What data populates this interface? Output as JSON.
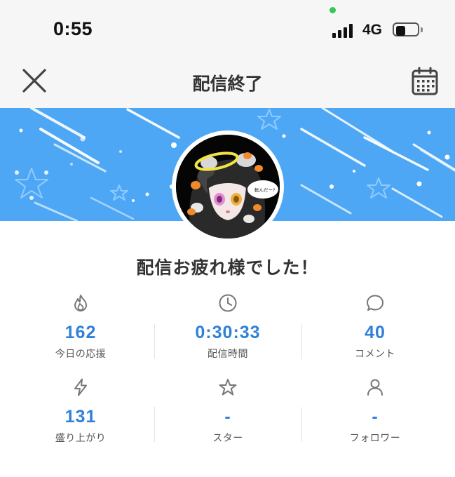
{
  "status_bar": {
    "time": "0:55",
    "network": "4G",
    "battery_percent": 35
  },
  "nav": {
    "title": "配信終了",
    "close_icon": "close-icon",
    "calendar_icon": "calendar-icon"
  },
  "avatar": {
    "speech_bubble_text": "転んだー?"
  },
  "message": "配信お疲れ様でした！",
  "stats": [
    {
      "icon": "flame-icon",
      "value": "162",
      "label": "今日の応援"
    },
    {
      "icon": "clock-icon",
      "value": "0:30:33",
      "label": "配信時間"
    },
    {
      "icon": "comment-icon",
      "value": "40",
      "label": "コメント"
    },
    {
      "icon": "lightning-icon",
      "value": "131",
      "label": "盛り上がり"
    },
    {
      "icon": "star-icon",
      "value": "-",
      "label": "スター"
    },
    {
      "icon": "person-icon",
      "value": "-",
      "label": "フォロワー"
    }
  ],
  "colors": {
    "accent": "#2f80d8",
    "banner": "#4ea7f4",
    "status_dot": "#35c759"
  }
}
